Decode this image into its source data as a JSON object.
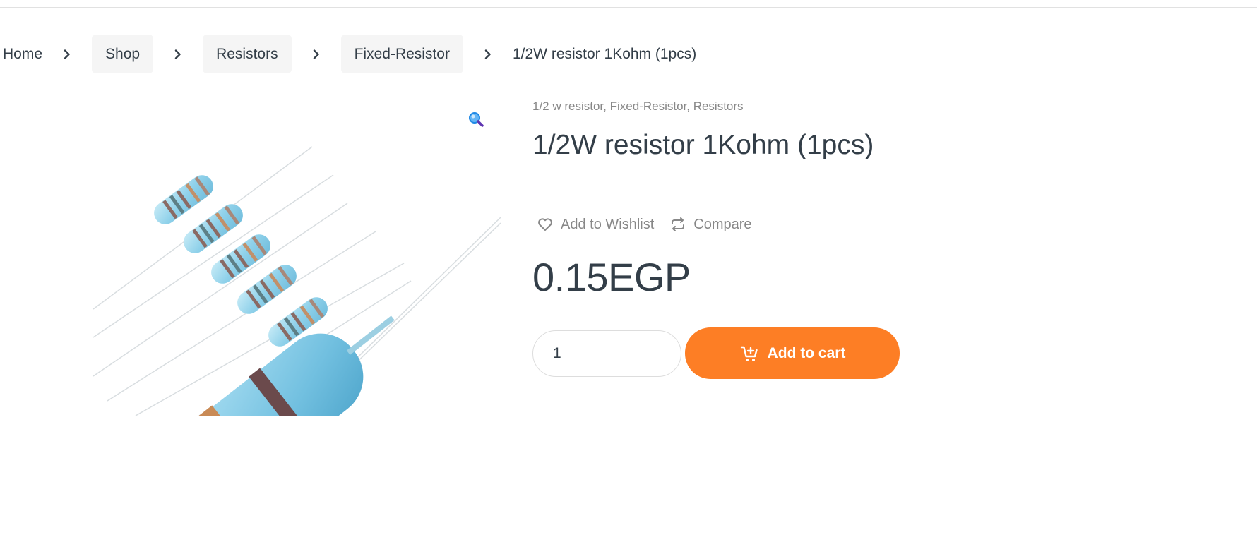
{
  "breadcrumb": {
    "items": [
      {
        "label": "Home"
      },
      {
        "label": "Shop"
      },
      {
        "label": "Resistors"
      },
      {
        "label": "Fixed-Resistor"
      }
    ],
    "current": "1/2W resistor 1Kohm (1pcs)"
  },
  "product": {
    "categories": [
      "1/2 w resistor",
      "Fixed-Resistor",
      "Resistors"
    ],
    "title": "1/2W resistor 1Kohm (1pcs)",
    "price": "0.15EGP",
    "image_icon": "resistor-product-photo"
  },
  "actions": {
    "wishlist_label": "Add to Wishlist",
    "compare_label": "Compare"
  },
  "cart": {
    "quantity": "1",
    "add_label": "Add to cart"
  },
  "colors": {
    "accent": "#fd7e25",
    "text": "#333e48",
    "muted": "#878787",
    "zoom_icon": "#1e88e5"
  }
}
